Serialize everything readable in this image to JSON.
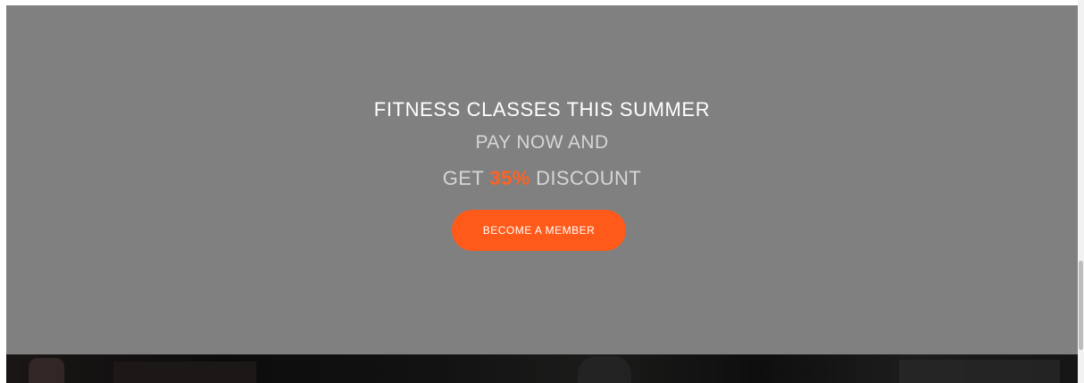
{
  "promo": {
    "headline": "FITNESS CLASSES THIS SUMMER",
    "line1": "PAY NOW AND",
    "line2_prefix": "GET ",
    "discount": "35%",
    "line2_suffix": " DISCOUNT",
    "cta_label": "BECOME A MEMBER"
  },
  "colors": {
    "overlay": "#808080",
    "accent": "#ff5a1a"
  }
}
